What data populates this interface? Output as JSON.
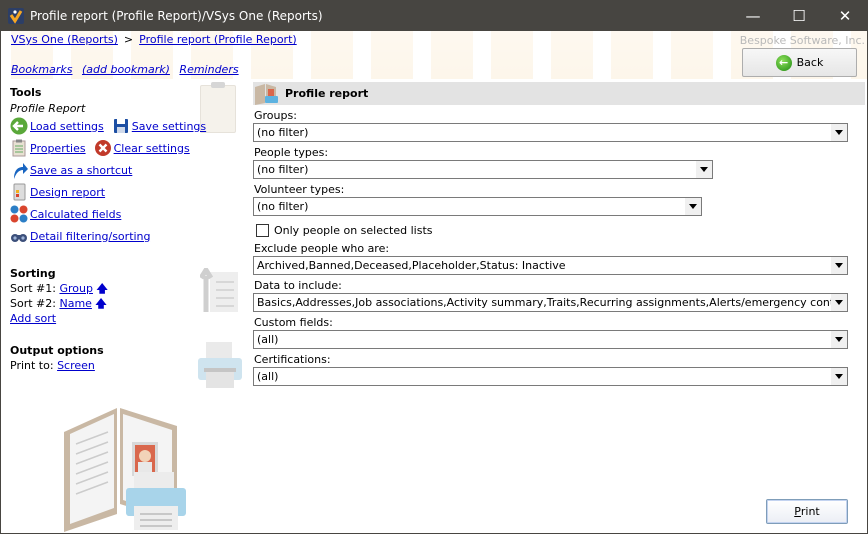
{
  "window": {
    "title": "Profile report (Profile Report)/VSys One (Reports)",
    "minimize": "—",
    "maximize": "☐",
    "close": "✕"
  },
  "breadcrumb": {
    "items": [
      "VSys One (Reports)",
      "Profile report (Profile Report)"
    ],
    "separator": ">"
  },
  "bookmarks": {
    "bookmarks": "Bookmarks",
    "add_bookmark": "(add bookmark)",
    "reminders": "Reminders"
  },
  "company": "Bespoke Software, Inc.",
  "back_button": "Back",
  "tools": {
    "title": "Tools",
    "subtitle": "Profile Report",
    "load_settings": "Load settings",
    "save_settings": "Save settings",
    "properties": "Properties",
    "clear_settings": "Clear settings",
    "save_shortcut": "Save as a shortcut",
    "design_report": "Design report",
    "calculated_fields": "Calculated fields",
    "detail_filtering": "Detail filtering/sorting"
  },
  "sorting": {
    "title": "Sorting",
    "sort1_label": "Sort #1:",
    "sort1_value": "Group",
    "sort2_label": "Sort #2:",
    "sort2_value": "Name",
    "add_sort": "Add sort"
  },
  "output": {
    "title": "Output options",
    "print_to_label": "Print to:",
    "print_to_value": "Screen"
  },
  "panel": {
    "title": "Profile report",
    "groups_label": "Groups:",
    "groups_value": "(no filter)",
    "people_types_label": "People types:",
    "people_types_value": "(no filter)",
    "volunteer_types_label": "Volunteer types:",
    "volunteer_types_value": "(no filter)",
    "only_selected_lists": "Only people on selected lists",
    "only_selected_lists_checked": false,
    "exclude_label": "Exclude people who are:",
    "exclude_value": "Archived,Banned,Deceased,Placeholder,Status: Inactive",
    "data_include_label": "Data to include:",
    "data_include_value": "Basics,Addresses,Job associations,Activity summary,Traits,Recurring assignments,Alerts/emergency contact,Interview",
    "custom_fields_label": "Custom fields:",
    "custom_fields_value": "(all)",
    "certifications_label": "Certifications:",
    "certifications_value": "(all)"
  },
  "print_button": {
    "accel": "P",
    "rest": "rint"
  }
}
